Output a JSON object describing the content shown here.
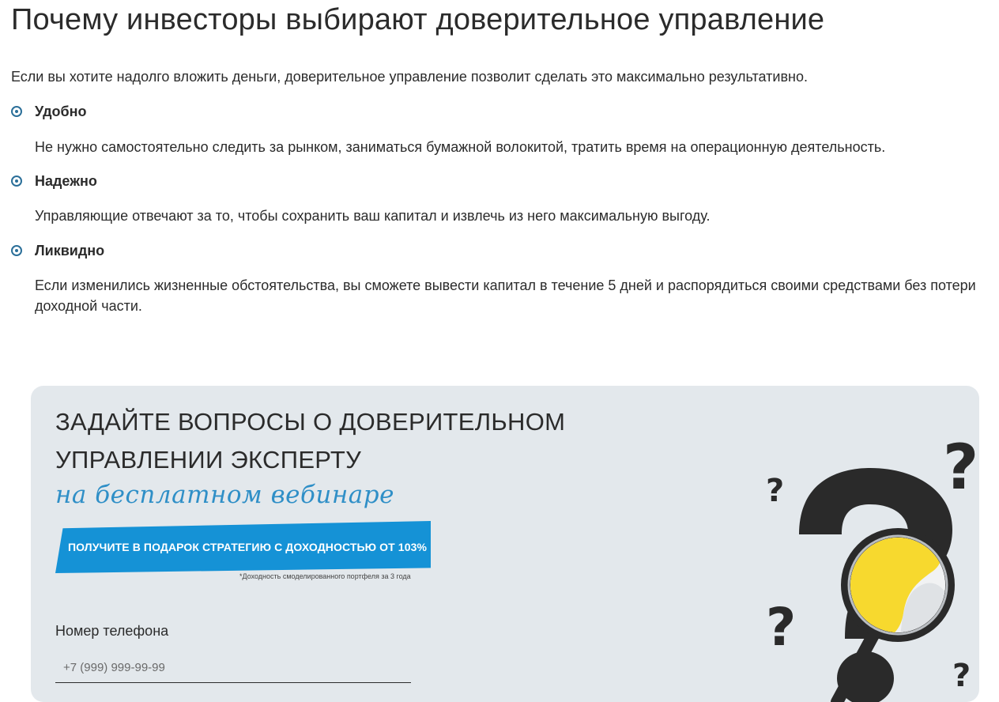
{
  "page": {
    "title": "Почему инвесторы выбирают доверительное управление",
    "intro": "Если вы хотите надолго вложить деньги, доверительное управление позволит сделать это максимально результативно."
  },
  "features": [
    {
      "title": "Удобно",
      "text": "Не нужно самостоятельно следить за рынком, заниматься бумажной волокитой, тратить время на операционную деятельность."
    },
    {
      "title": "Надежно",
      "text": "Управляющие отвечают за то, чтобы сохранить ваш капитал и извлечь из него максимальную выгоду."
    },
    {
      "title": "Ликвидно",
      "text": "Если изменились жизненные обстоятельства, вы сможете вывести капитал в течение 5 дней и распорядиться своими средствами без потери доходной части."
    }
  ],
  "banner": {
    "heading_line1": "ЗАДАЙТЕ ВОПРОСЫ О ДОВЕРИТЕЛЬНОМ",
    "heading_line2": "УПРАВЛЕНИИ ЭКСПЕРТУ",
    "subheading": "на бесплатном вебинаре",
    "promo": "ПОЛУЧИТЕ В ПОДАРОК СТРАТЕГИЮ С ДОХОДНОСТЬЮ ОТ 103%",
    "footnote": "*Доходность смоделированного портфеля за 3 года",
    "phone_label": "Номер телефона",
    "phone_placeholder": "+7 (999) 999-99-99",
    "illustration": "question-marks-magnifier-illustration"
  },
  "colors": {
    "accent_blue": "#1592d6",
    "subheading_blue": "#2f8fc7",
    "bullet_blue": "#2b6f99",
    "banner_bg": "#e3e8ec",
    "magnifier_yellow": "#f7d92e",
    "text_dark": "#2b2b2b"
  }
}
